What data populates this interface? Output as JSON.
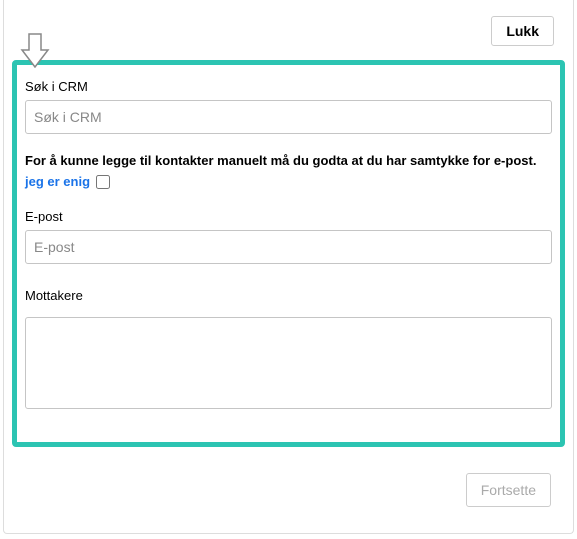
{
  "top": {
    "close_label": "Lukk"
  },
  "highlight": {
    "search_label": "Søk i CRM",
    "search_placeholder": "Søk i CRM",
    "consent_text": "For å kunne legge til kontakter manuelt må du godta at du har samtykke for e-post.",
    "agree_label": "jeg er enig",
    "email_label": "E-post",
    "email_placeholder": "E-post",
    "recipients_label": "Mottakere"
  },
  "bottom": {
    "continue_label": "Fortsette"
  }
}
